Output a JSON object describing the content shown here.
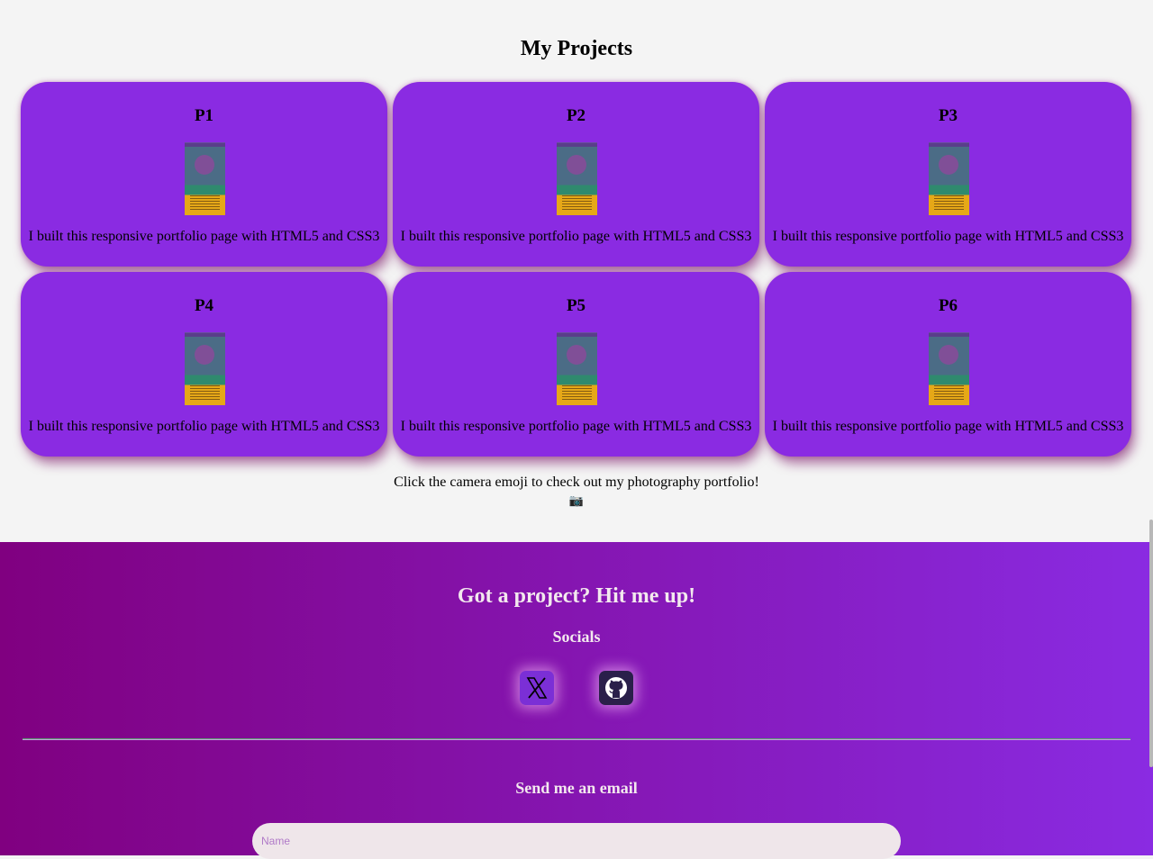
{
  "projects": {
    "title": "My Projects",
    "items": [
      {
        "title": "P1",
        "description": "I built this responsive portfolio page with HTML5 and CSS3"
      },
      {
        "title": "P2",
        "description": "I built this responsive portfolio page with HTML5 and CSS3"
      },
      {
        "title": "P3",
        "description": "I built this responsive portfolio page with HTML5 and CSS3"
      },
      {
        "title": "P4",
        "description": "I built this responsive portfolio page with HTML5 and CSS3"
      },
      {
        "title": "P5",
        "description": "I built this responsive portfolio page with HTML5 and CSS3"
      },
      {
        "title": "P6",
        "description": "I built this responsive portfolio page with HTML5 and CSS3"
      }
    ]
  },
  "photography": {
    "text": "Click the camera emoji to check out my photography portfolio!",
    "emoji": "📷"
  },
  "contact": {
    "heading": "Got a project? Hit me up!",
    "socials_title": "Socials",
    "socials": [
      {
        "name": "x-icon"
      },
      {
        "name": "github-icon"
      }
    ],
    "email_title": "Send me an email",
    "name_placeholder": "Name"
  },
  "colors": {
    "card": "#8a2be2",
    "footer_start": "#800080",
    "footer_end": "#8a2be2",
    "background": "#f4f4f4"
  }
}
